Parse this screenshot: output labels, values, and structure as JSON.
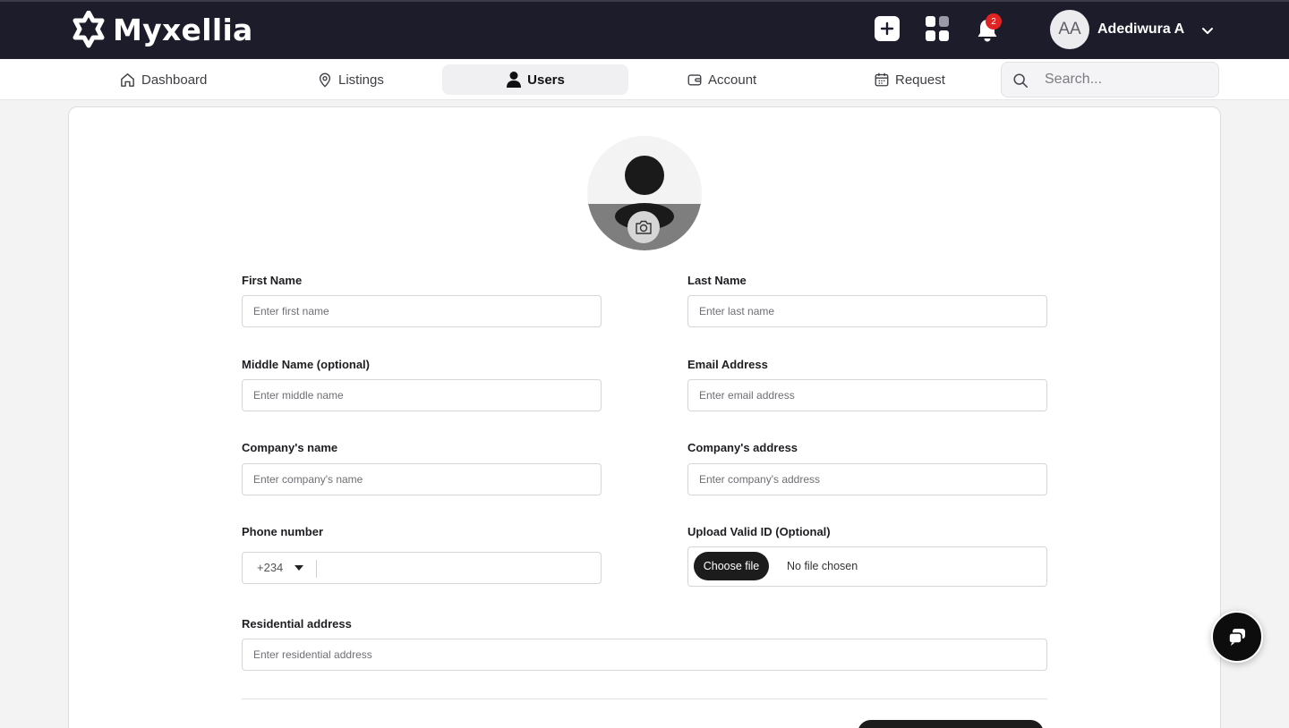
{
  "brand": {
    "name": "Myxellia"
  },
  "topbar": {
    "notification_count": "2",
    "user": {
      "initials": "AA",
      "name": "Adediwura A"
    }
  },
  "nav": {
    "items": [
      {
        "label": "Dashboard",
        "icon": "home-icon"
      },
      {
        "label": "Listings",
        "icon": "map-pin-icon"
      },
      {
        "label": "Users",
        "icon": "user-icon",
        "active": true
      },
      {
        "label": "Account",
        "icon": "wallet-icon"
      },
      {
        "label": "Request",
        "icon": "calendar-icon"
      }
    ],
    "search_placeholder": "Search..."
  },
  "form": {
    "first_name": {
      "label": "First Name",
      "placeholder": "Enter first name"
    },
    "last_name": {
      "label": "Last Name",
      "placeholder": "Enter last name"
    },
    "middle_name": {
      "label": "Middle Name (optional)",
      "placeholder": "Enter middle name"
    },
    "email": {
      "label": "Email Address",
      "placeholder": "Enter email address"
    },
    "company_name": {
      "label": "Company's name",
      "placeholder": "Enter company's name"
    },
    "company_address": {
      "label": "Company's address",
      "placeholder": "Enter company's address"
    },
    "phone": {
      "label": "Phone number",
      "country_code": "+234"
    },
    "valid_id": {
      "label": "Upload Valid ID (Optional)",
      "button": "Choose file",
      "status": "No file chosen"
    },
    "residential_address": {
      "label": "Residential address",
      "placeholder": "Enter residential address"
    }
  },
  "colors": {
    "topbar": "#1d1c2b",
    "badge": "#e02424",
    "primary_button": "#1c1c1c"
  }
}
